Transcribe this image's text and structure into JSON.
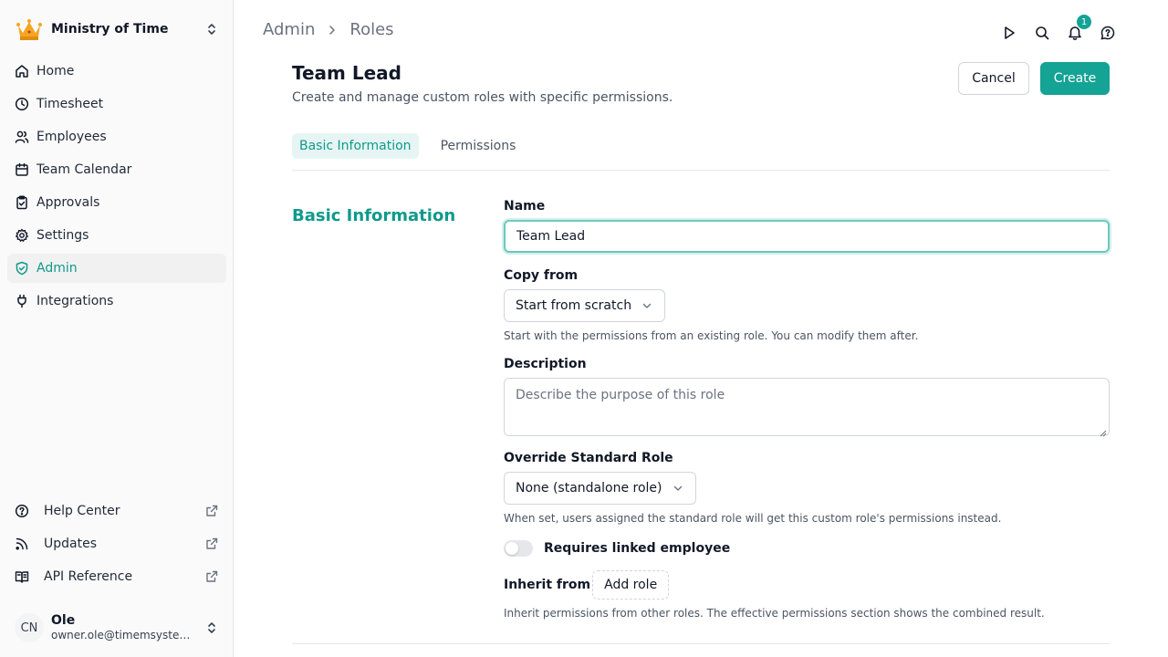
{
  "org": {
    "name": "Ministry of Time",
    "logo_icon": "crown-icon"
  },
  "nav": [
    {
      "label": "Home",
      "icon": "home-icon"
    },
    {
      "label": "Timesheet",
      "icon": "clock-icon"
    },
    {
      "label": "Employees",
      "icon": "users-icon"
    },
    {
      "label": "Team Calendar",
      "icon": "calendar-icon"
    },
    {
      "label": "Approvals",
      "icon": "clipboard-check-icon"
    },
    {
      "label": "Settings",
      "icon": "gear-icon"
    },
    {
      "label": "Admin",
      "icon": "shield-check-icon",
      "active": true
    },
    {
      "label": "Integrations",
      "icon": "plug-icon"
    }
  ],
  "footer_nav": [
    {
      "label": "Help Center",
      "icon": "help-circle-icon"
    },
    {
      "label": "Updates",
      "icon": "rss-icon"
    },
    {
      "label": "API Reference",
      "icon": "book-icon"
    }
  ],
  "user": {
    "initials": "CN",
    "name": "Ole",
    "email": "owner.ole@timemsystem.com"
  },
  "breadcrumb": [
    "Admin",
    "Roles"
  ],
  "notifications": {
    "count": "1"
  },
  "page": {
    "title": "Team Lead",
    "subtitle": "Create and manage custom roles with specific permissions.",
    "cancel_label": "Cancel",
    "create_label": "Create"
  },
  "tabs": [
    {
      "label": "Basic Information",
      "active": true
    },
    {
      "label": "Permissions",
      "active": false
    }
  ],
  "section": {
    "title": "Basic Information"
  },
  "form": {
    "name_label": "Name",
    "name_value": "Team Lead",
    "copy_label": "Copy from",
    "copy_value": "Start from scratch",
    "copy_help": "Start with the permissions from an existing role. You can modify them after.",
    "description_label": "Description",
    "description_placeholder": "Describe the purpose of this role",
    "override_label": "Override Standard Role",
    "override_value": "None (standalone role)",
    "override_help": "When set, users assigned the standard role will get this custom role's permissions instead.",
    "requires_label": "Requires linked employee",
    "requires_on": false,
    "inherit_label": "Inherit from",
    "add_role_label": "Add role",
    "inherit_help": "Inherit permissions from other roles. The effective permissions section shows the combined result."
  },
  "colors": {
    "accent": "#14a394",
    "accent_text": "#0f9a8c"
  }
}
